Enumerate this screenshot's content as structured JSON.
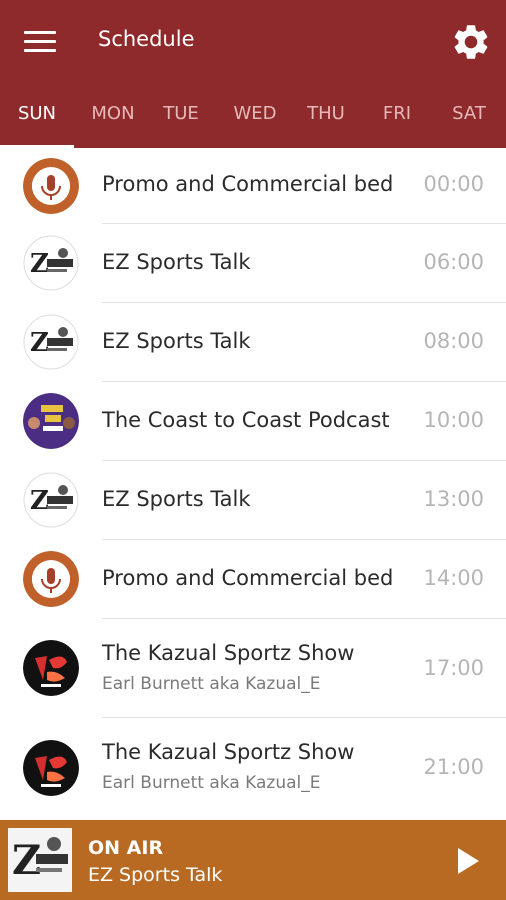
{
  "header": {
    "title": "Schedule",
    "menu_icon": "hamburger-menu-icon",
    "settings_icon": "gear-icon"
  },
  "tabs": [
    {
      "label": "SUN",
      "active": true
    },
    {
      "label": "MON"
    },
    {
      "label": "TUE"
    },
    {
      "label": "WED"
    },
    {
      "label": "THU"
    },
    {
      "label": "FRI"
    },
    {
      "label": "SAT"
    }
  ],
  "schedule": [
    {
      "title": "Promo and Commercial bed",
      "time": "00:00",
      "logo": "ksrn-logo"
    },
    {
      "title": "EZ Sports Talk",
      "time": "06:00",
      "logo": "ez-sports-logo"
    },
    {
      "title": "EZ Sports Talk",
      "time": "08:00",
      "logo": "ez-sports-logo"
    },
    {
      "title": "The Coast to Coast Podcast",
      "time": "10:00",
      "logo": "coast-podcast-logo"
    },
    {
      "title": "EZ Sports Talk",
      "time": "13:00",
      "logo": "ez-sports-logo"
    },
    {
      "title": "Promo and Commercial bed",
      "time": "14:00",
      "logo": "ksrn-logo"
    },
    {
      "title": "The Kazual Sportz Show",
      "subtitle": "Earl Burnett aka Kazual_E",
      "time": "17:00",
      "logo": "kazual-logo"
    },
    {
      "title": "The Kazual Sportz Show",
      "subtitle": "Earl Burnett aka Kazual_E",
      "time": "21:00",
      "logo": "kazual-logo"
    }
  ],
  "player": {
    "status": "ON AIR",
    "show": "EZ Sports Talk",
    "play_icon": "play-icon"
  },
  "colors": {
    "header_bg": "#8e2a2b",
    "player_bg": "#b86a22",
    "time_text": "#b5b5b5"
  }
}
